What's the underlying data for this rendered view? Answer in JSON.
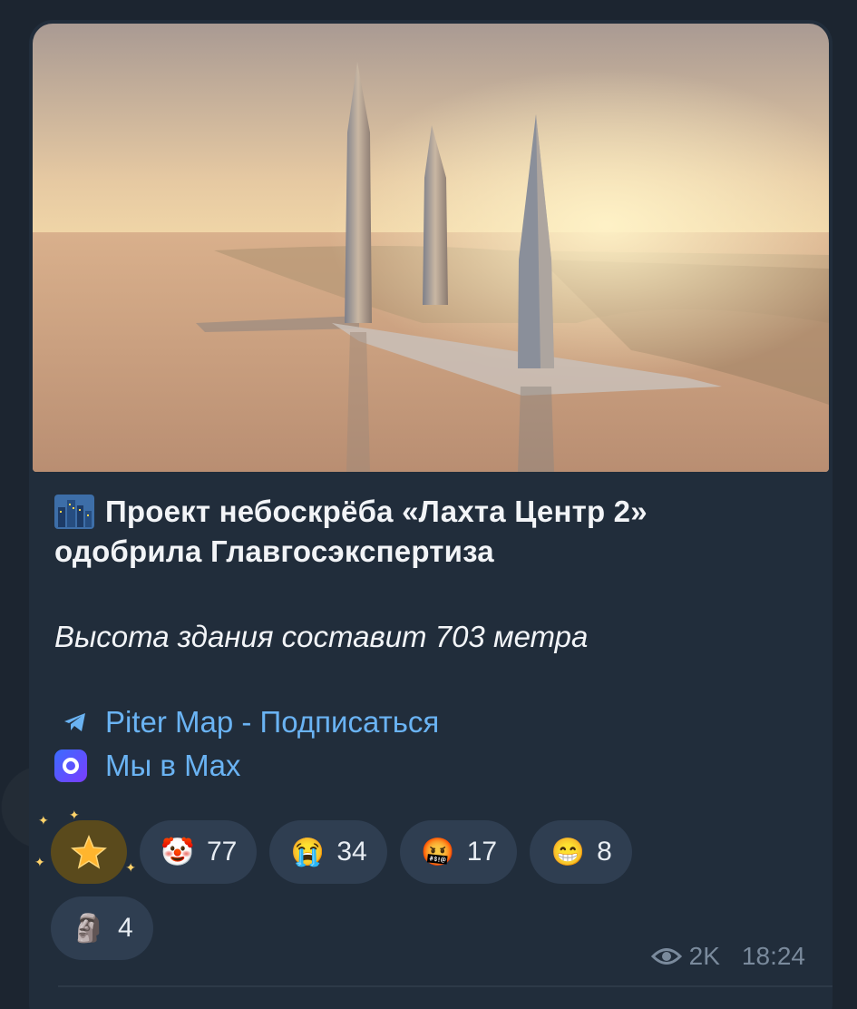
{
  "post": {
    "title_line1": "Проект небоскрёба «Лахта Центр 2»",
    "title_line2": "одобрила Главгосэкспертиза",
    "subtitle": "Высота здания составит 703 метра",
    "link_subscribe": "Piter Map - Подписаться",
    "link_max": "Мы в Max",
    "title_icon": "cityscape-emoji",
    "photo_icon": "skyscraper-photo"
  },
  "reactions": [
    {
      "name": "star-icon",
      "count": ""
    },
    {
      "name": "clown-face-icon",
      "emoji": "🤡",
      "count": "77"
    },
    {
      "name": "crying-face-icon",
      "emoji": "😭",
      "count": "34"
    },
    {
      "name": "cursing-face-icon",
      "emoji": "🤬",
      "count": "17"
    },
    {
      "name": "grinning-face-icon",
      "emoji": "😁",
      "count": "8"
    },
    {
      "name": "moai-icon",
      "emoji": "🗿",
      "count": "4"
    }
  ],
  "meta": {
    "views": "2K",
    "time": "18:24"
  },
  "colors": {
    "bubble": "#212d3b",
    "link": "#6ab3f3",
    "chip": "#2f3e51"
  }
}
